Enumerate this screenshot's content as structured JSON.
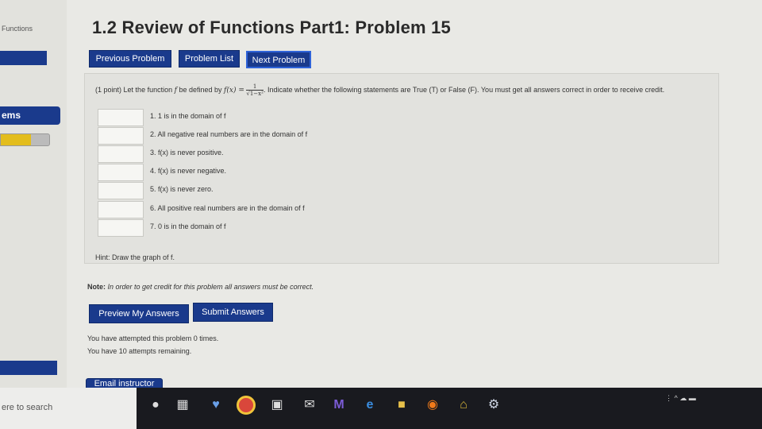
{
  "sidebar": {
    "title": "Functions",
    "items_label": "ems",
    "progress_fraction": 0.63
  },
  "page_title": "1.2 Review of Functions Part1: Problem 15",
  "nav": {
    "previous": "Previous Problem",
    "list": "Problem List",
    "next": "Next Problem"
  },
  "problem": {
    "points": "(1 point)",
    "intro_a": "Let the function",
    "intro_b": "be defined by",
    "func": "f(x) =",
    "fraction_num": "1",
    "fraction_den": "√1−x²",
    "intro_c": ". Indicate whether the following statements are True (T) or False (F). You must get all answers correct in order to receive credit.",
    "f_var": "f",
    "statements": [
      {
        "label": "1. 1 is in the domain of f",
        "value": ""
      },
      {
        "label": "2. All negative real numbers are in the domain of f",
        "value": ""
      },
      {
        "label": "3. f(x) is never positive.",
        "value": ""
      },
      {
        "label": "4. f(x) is never negative.",
        "value": ""
      },
      {
        "label": "5. f(x) is never zero.",
        "value": ""
      },
      {
        "label": "6. All positive real numbers are in the domain of f",
        "value": ""
      },
      {
        "label": "7. 0 is in the domain of f",
        "value": ""
      }
    ],
    "hint": "Hint: Draw the graph of f."
  },
  "note": {
    "label": "Note:",
    "text": "In order to get credit for this problem all answers must be correct."
  },
  "actions": {
    "preview": "Preview My Answers",
    "submit": "Submit Answers",
    "email": "Email instructor"
  },
  "attempts": {
    "line1": "You have attempted this problem 0 times.",
    "line2": "You have 10 attempts remaining."
  },
  "taskbar": {
    "search_text": "ere to search",
    "icons": [
      "microphone-icon",
      "task-view-icon",
      "people-icon",
      "chrome-icon",
      "store-icon",
      "mail-icon",
      "maple-icon",
      "edge-icon",
      "file-explorer-icon",
      "origin-icon",
      "home-icon",
      "steam-icon"
    ]
  },
  "colors": {
    "nav_blue": "#1a3a8c",
    "progress": "#e3bd1c",
    "taskbar": "#191a1f"
  }
}
